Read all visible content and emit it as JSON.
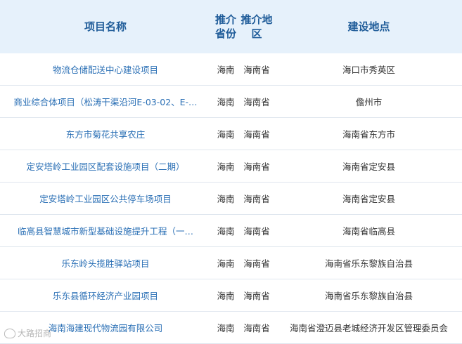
{
  "header": {
    "name": "项目名称",
    "province": "推介省份",
    "region": "推介地区",
    "site": "建设地点"
  },
  "rows": [
    {
      "name": "物流仓储配送中心建设项目",
      "province": "海南",
      "region": "海南省",
      "site": "海口市秀英区"
    },
    {
      "name": "商业综合体项目（松涛干渠沿河E-03-02、E-…",
      "province": "海南",
      "region": "海南省",
      "site": "儋州市"
    },
    {
      "name": "东方市菊花共享农庄",
      "province": "海南",
      "region": "海南省",
      "site": "海南省东方市"
    },
    {
      "name": "定安塔岭工业园区配套设施项目（二期）",
      "province": "海南",
      "region": "海南省",
      "site": "海南省定安县"
    },
    {
      "name": "定安塔岭工业园区公共停车场项目",
      "province": "海南",
      "region": "海南省",
      "site": "海南省定安县"
    },
    {
      "name": "临高县智慧城市新型基础设施提升工程（一…",
      "province": "海南",
      "region": "海南省",
      "site": "海南省临高县"
    },
    {
      "name": "乐东岭头揽胜驿站项目",
      "province": "海南",
      "region": "海南省",
      "site": "海南省乐东黎族自治县"
    },
    {
      "name": "乐东县循环经济产业园项目",
      "province": "海南",
      "region": "海南省",
      "site": "海南省乐东黎族自治县"
    },
    {
      "name": "海南海建现代物流园有限公司",
      "province": "海南",
      "region": "海南省",
      "site": "海南省澄迈县老城经济开发区管理委员会"
    }
  ],
  "watermark": {
    "text": "大路招商"
  },
  "colors": {
    "header_bg": "#e6f1fb",
    "header_text": "#1f5c99",
    "link": "#2a6fb5"
  }
}
